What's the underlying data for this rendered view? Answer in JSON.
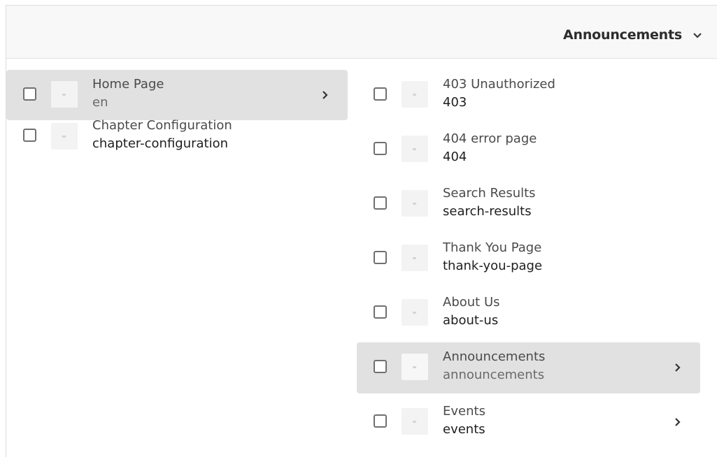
{
  "header": {
    "title": "Announcements"
  },
  "column1": [
    {
      "title": "Home Page",
      "name": "en"
    },
    {
      "title": "Chapter Configuration",
      "name": "chapter-configuration"
    }
  ],
  "column2": [
    {
      "title": "403 Unauthorized",
      "name": "403"
    },
    {
      "title": "404 error page",
      "name": "404"
    },
    {
      "title": "Search Results",
      "name": "search-results"
    },
    {
      "title": "Thank You Page",
      "name": "thank-you-page"
    },
    {
      "title": "About Us",
      "name": "about-us"
    },
    {
      "title": "Announcements",
      "name": "announcements"
    },
    {
      "title": "Events",
      "name": "events"
    }
  ]
}
